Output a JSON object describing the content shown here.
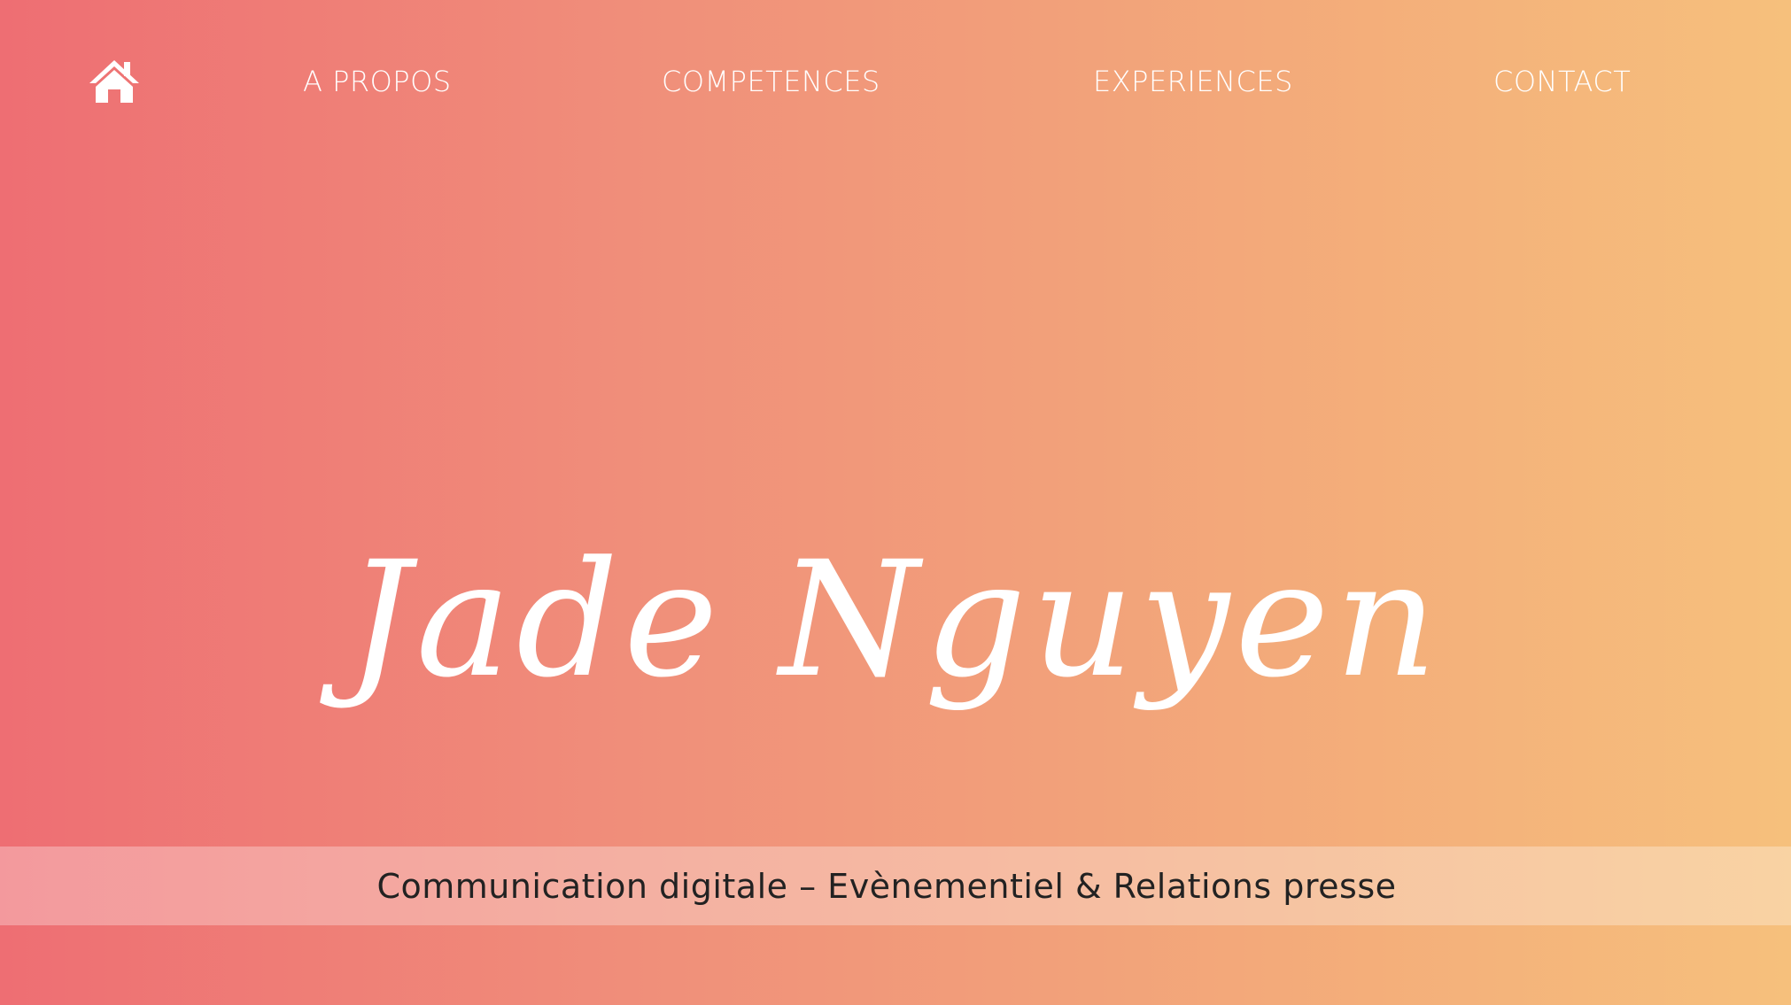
{
  "nav": {
    "home_icon": "home-icon",
    "items": [
      {
        "label": "A PROPOS"
      },
      {
        "label": "COMPETENCES"
      },
      {
        "label": "EXPERIENCES"
      },
      {
        "label": "CONTACT"
      }
    ]
  },
  "hero": {
    "name": "Jade Nguyen"
  },
  "tagline": {
    "text": "Communication digitale – Evènementiel & Relations presse"
  },
  "colors": {
    "gradient_start": "#ee6e73",
    "gradient_end": "#f6c07c",
    "text_light": "#ffffff",
    "text_dark": "#222222"
  }
}
